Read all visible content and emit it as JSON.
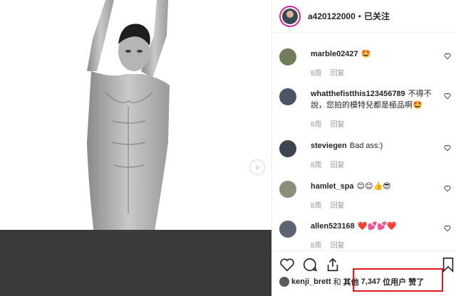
{
  "header": {
    "username": "a420122000",
    "separator": "•",
    "follow_status": "已关注"
  },
  "comments": [
    {
      "user": "marble02427",
      "text": "🤩",
      "time": "8周",
      "reply": "回复"
    },
    {
      "user": "whatthefistthis123456789",
      "text": "不得不說，您拍的模特兒都是極品啊🤩",
      "time": "8周",
      "reply": "回复"
    },
    {
      "user": "steviegen",
      "text": "Bad ass:)",
      "time": "8周",
      "reply": "回复"
    },
    {
      "user": "hamlet_spa",
      "text": "😊😊👍😎",
      "time": "8周",
      "reply": "回复"
    },
    {
      "user": "allen523168",
      "text": "❤️💕💕❤️",
      "time": "8周",
      "reply": "回复"
    }
  ],
  "likes": {
    "user": "kenji_brett",
    "and": "和",
    "others": "其他",
    "count": "7,347",
    "suffix": "位用户 赞了"
  },
  "icons": {
    "next": "chevron-right-icon",
    "like": "heart-icon",
    "comment": "comment-icon",
    "share": "share-icon",
    "save": "bookmark-icon"
  },
  "colors": {
    "highlight": "#e21818",
    "dark_block": "#3a3a3a",
    "story_ring": "#d6249f"
  }
}
